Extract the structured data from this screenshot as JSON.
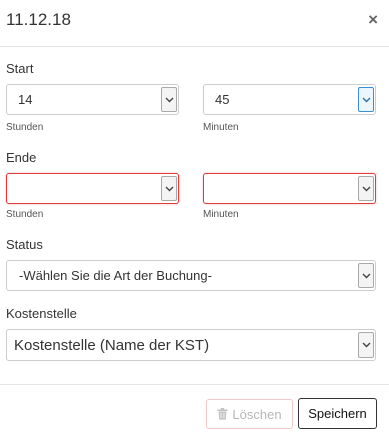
{
  "dialog": {
    "title": "11.12.18",
    "close_glyph": "×"
  },
  "start": {
    "label": "Start",
    "hours": {
      "value": "14",
      "caption": "Stunden"
    },
    "minutes": {
      "value": "45",
      "caption": "Minuten"
    }
  },
  "end": {
    "label": "Ende",
    "hours": {
      "value": "",
      "caption": "Stunden"
    },
    "minutes": {
      "value": "",
      "caption": "Minuten"
    }
  },
  "status": {
    "label": "Status",
    "value": "-Wählen Sie die Art der Buchung-"
  },
  "cost_center": {
    "label": "Kostenstelle",
    "value": "Kostenstelle (Name der KST)"
  },
  "buttons": {
    "delete_label": "Löschen",
    "save_label": "Speichern"
  },
  "colors": {
    "error_border": "#e03c3c",
    "focus_arrow_border": "#3b8fd6",
    "delete_icon": "#c2c2c2"
  },
  "icons": {
    "close": "close-icon",
    "dropdown": "chevron-down-icon",
    "delete": "trash-icon"
  }
}
